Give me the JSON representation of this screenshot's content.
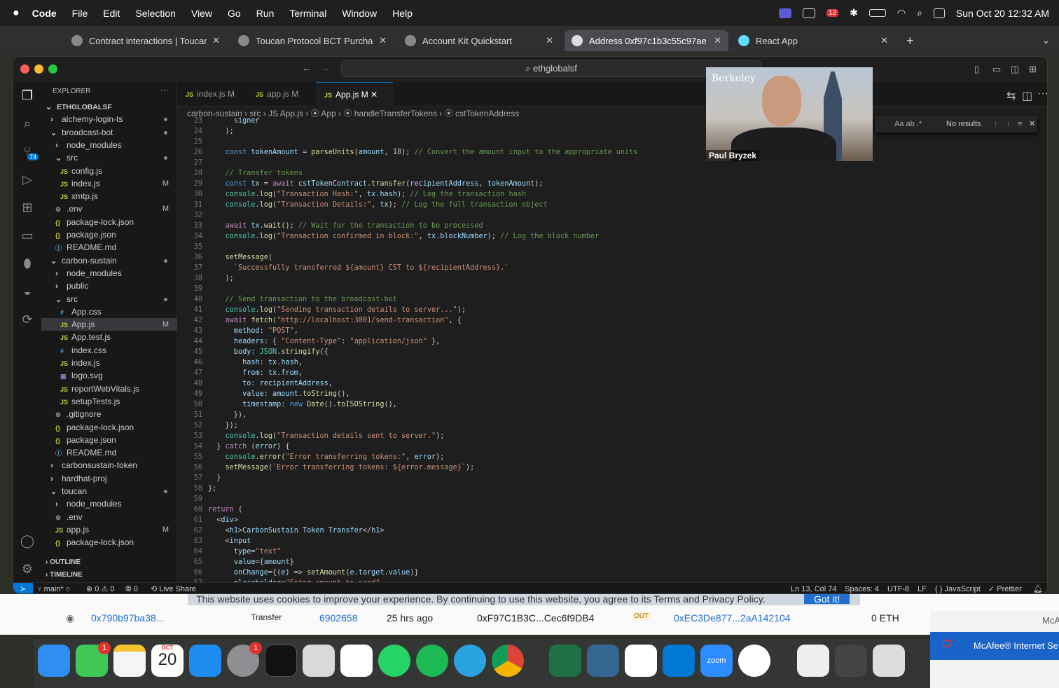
{
  "menubar": {
    "app_name": "Code",
    "menus": [
      "File",
      "Edit",
      "Selection",
      "View",
      "Go",
      "Run",
      "Terminal",
      "Window",
      "Help"
    ],
    "clock": "Sun Oct 20  12:32 AM",
    "badge": "12"
  },
  "browser": {
    "tabs": [
      {
        "label": "Contract interactions | Toucan"
      },
      {
        "label": "Toucan Protocol BCT Purchase"
      },
      {
        "label": "Account Kit Quickstart"
      },
      {
        "label": "Address 0xf97c1b3c55c97ae"
      },
      {
        "label": "React App"
      }
    ],
    "new_tab": "+"
  },
  "vscode": {
    "command_center": "ethglobalsf",
    "explorer_title": "EXPLORER",
    "activity_badge": "74",
    "tree": [
      {
        "label": "ETHGLOBALSF",
        "depth": 0,
        "kind": "root"
      },
      {
        "label": "alchemy-login-ts",
        "depth": 1,
        "kind": "closed",
        "mark": "dot"
      },
      {
        "label": "broadcast-bot",
        "depth": 1,
        "kind": "open",
        "mark": "dot"
      },
      {
        "label": "node_modules",
        "depth": 2,
        "kind": "closed",
        "mark": ""
      },
      {
        "label": "src",
        "depth": 2,
        "kind": "open",
        "mark": "dot"
      },
      {
        "label": "config.js",
        "depth": 3,
        "kind": "js",
        "mark": ""
      },
      {
        "label": "index.js",
        "depth": 3,
        "kind": "js",
        "mark": "M"
      },
      {
        "label": "xmtp.js",
        "depth": 3,
        "kind": "js",
        "mark": ""
      },
      {
        "label": ".env",
        "depth": 2,
        "kind": "gear",
        "mark": "M"
      },
      {
        "label": "package-lock.json",
        "depth": 2,
        "kind": "json",
        "mark": ""
      },
      {
        "label": "package.json",
        "depth": 2,
        "kind": "json",
        "mark": ""
      },
      {
        "label": "README.md",
        "depth": 2,
        "kind": "info",
        "mark": ""
      },
      {
        "label": "carbon-sustain",
        "depth": 1,
        "kind": "open",
        "mark": "dot"
      },
      {
        "label": "node_modules",
        "depth": 2,
        "kind": "closed",
        "mark": ""
      },
      {
        "label": "public",
        "depth": 2,
        "kind": "closed",
        "mark": ""
      },
      {
        "label": "src",
        "depth": 2,
        "kind": "open",
        "mark": "dot"
      },
      {
        "label": "App.css",
        "depth": 3,
        "kind": "css",
        "mark": ""
      },
      {
        "label": "App.js",
        "depth": 3,
        "kind": "js",
        "mark": "M",
        "selected": true
      },
      {
        "label": "App.test.js",
        "depth": 3,
        "kind": "js",
        "mark": ""
      },
      {
        "label": "index.css",
        "depth": 3,
        "kind": "css",
        "mark": ""
      },
      {
        "label": "index.js",
        "depth": 3,
        "kind": "js",
        "mark": ""
      },
      {
        "label": "logo.svg",
        "depth": 3,
        "kind": "svg",
        "mark": ""
      },
      {
        "label": "reportWebVitals.js",
        "depth": 3,
        "kind": "js",
        "mark": ""
      },
      {
        "label": "setupTests.js",
        "depth": 3,
        "kind": "js",
        "mark": ""
      },
      {
        "label": ".gitignore",
        "depth": 2,
        "kind": "gear",
        "mark": ""
      },
      {
        "label": "package-lock.json",
        "depth": 2,
        "kind": "json",
        "mark": ""
      },
      {
        "label": "package.json",
        "depth": 2,
        "kind": "json",
        "mark": ""
      },
      {
        "label": "README.md",
        "depth": 2,
        "kind": "info",
        "mark": ""
      },
      {
        "label": "carbonsustain-token",
        "depth": 1,
        "kind": "closed",
        "mark": ""
      },
      {
        "label": "hardhat-proj",
        "depth": 1,
        "kind": "closed",
        "mark": ""
      },
      {
        "label": "toucan",
        "depth": 1,
        "kind": "open",
        "mark": "dot"
      },
      {
        "label": "node_modules",
        "depth": 2,
        "kind": "closed",
        "mark": ""
      },
      {
        "label": ".env",
        "depth": 2,
        "kind": "gear",
        "mark": ""
      },
      {
        "label": "app.js",
        "depth": 2,
        "kind": "js",
        "mark": "M"
      },
      {
        "label": "package-lock.json",
        "depth": 2,
        "kind": "json",
        "mark": ""
      }
    ],
    "outline": "OUTLINE",
    "timeline": "TIMELINE",
    "editor_tabs": [
      {
        "label": "index.js",
        "mark": "M"
      },
      {
        "label": "app.js",
        "mark": "M"
      },
      {
        "label": "App.js",
        "mark": "M",
        "active": true
      }
    ],
    "breadcrumb": "carbon-sustain  ›  src  ›  JS App.js  ›  ⦿ App  ›  ⦿ handleTransferTokens  ›  ⦿ cstTokenAddress",
    "find_widget": {
      "options": "Aa  ab  .*",
      "result": "No results"
    },
    "code_lines": [
      {
        "n": "23",
        "src": "      signer"
      },
      {
        "n": "24",
        "src": "    );"
      },
      {
        "n": "25",
        "src": ""
      },
      {
        "n": "26",
        "src": "    const tokenAmount = parseUnits(amount, 18); // Convert the amount input to the appropriate units"
      },
      {
        "n": "27",
        "src": ""
      },
      {
        "n": "28",
        "src": "    // Transfer tokens"
      },
      {
        "n": "29",
        "src": "    const tx = await cstTokenContract.transfer(recipientAddress, tokenAmount);"
      },
      {
        "n": "30",
        "src": "    console.log(\"Transaction Hash:\", tx.hash); // Log the transaction hash"
      },
      {
        "n": "31",
        "src": "    console.log(\"Transaction Details:\", tx); // Log the full transaction object"
      },
      {
        "n": "32",
        "src": ""
      },
      {
        "n": "33",
        "src": "    await tx.wait(); // Wait for the transaction to be processed"
      },
      {
        "n": "34",
        "src": "    console.log(\"Transaction confirmed in block:\", tx.blockNumber); // Log the block number"
      },
      {
        "n": "35",
        "src": ""
      },
      {
        "n": "36",
        "src": "    setMessage("
      },
      {
        "n": "37",
        "src": "      `Successfully transferred ${amount} CST to ${recipientAddress}.`"
      },
      {
        "n": "38",
        "src": "    );"
      },
      {
        "n": "39",
        "src": ""
      },
      {
        "n": "40",
        "src": "    // Send transaction to the broadcast-bot"
      },
      {
        "n": "41",
        "src": "    console.log(\"Sending transaction details to server...\");"
      },
      {
        "n": "42",
        "src": "    await fetch(\"http://localhost:3001/send-transaction\", {"
      },
      {
        "n": "43",
        "src": "      method: \"POST\","
      },
      {
        "n": "44",
        "src": "      headers: { \"Content-Type\": \"application/json\" },"
      },
      {
        "n": "45",
        "src": "      body: JSON.stringify({"
      },
      {
        "n": "46",
        "src": "        hash: tx.hash,"
      },
      {
        "n": "47",
        "src": "        from: tx.from,"
      },
      {
        "n": "48",
        "src": "        to: recipientAddress,"
      },
      {
        "n": "49",
        "src": "        value: amount.toString(),"
      },
      {
        "n": "50",
        "src": "        timestamp: new Date().toISOString(),"
      },
      {
        "n": "51",
        "src": "      }),"
      },
      {
        "n": "52",
        "src": "    });"
      },
      {
        "n": "53",
        "src": "    console.log(\"Transaction details sent to server.\");"
      },
      {
        "n": "54",
        "src": "  } catch (error) {"
      },
      {
        "n": "55",
        "src": "    console.error(\"Error transferring tokens:\", error);"
      },
      {
        "n": "56",
        "src": "    setMessage(`Error transferring tokens: ${error.message}`);"
      },
      {
        "n": "57",
        "src": "  }"
      },
      {
        "n": "58",
        "src": "};"
      },
      {
        "n": "59",
        "src": ""
      },
      {
        "n": "60",
        "src": "return ("
      },
      {
        "n": "61",
        "src": "  <div>"
      },
      {
        "n": "62",
        "src": "    <h1>CarbonSustain Token Transfer</h1>"
      },
      {
        "n": "63",
        "src": "    <input"
      },
      {
        "n": "64",
        "src": "      type=\"text\""
      },
      {
        "n": "65",
        "src": "      value={amount}"
      },
      {
        "n": "66",
        "src": "      onChange={(e) => setAmount(e.target.value)}"
      },
      {
        "n": "67",
        "src": "      placeholder=\"Enter amount to send\""
      }
    ],
    "status": {
      "branch": "main*",
      "problems": "⊗ 0 ⚠ 0",
      "ports": "⦾ 0",
      "live_share": "Live Share",
      "position": "Ln 13, Col 74",
      "spaces": "Spaces: 4",
      "encoding": "UTF-8",
      "eol": "LF",
      "language": "{ } JavaScript",
      "prettier": "✓ Prettier"
    }
  },
  "webcam": {
    "name": "Paul Bryzek",
    "caption": "Berkeley"
  },
  "webpage": {
    "cookie_text": "This website uses cookies to improve your experience. By continuing to use this website, you agree to its Terms and Privacy Policy.",
    "cookie_button": "Got it!",
    "row": {
      "hash": "0x790b97ba38...",
      "method": "Transfer",
      "block": "6902658",
      "age": "25 hrs ago",
      "from": "0xF97C1B3C...Cec6f9DB4",
      "direction": "OUT",
      "to": "0xEC3De877...2aA142104",
      "value": "0 ETH"
    }
  },
  "notification": {
    "app": "McAfee® Internet Se",
    "short": "McA"
  },
  "dock": {
    "badges": [
      "1",
      "1"
    ],
    "calendar": {
      "month": "OCT",
      "day": "20"
    },
    "zoom_label": "zoom"
  }
}
